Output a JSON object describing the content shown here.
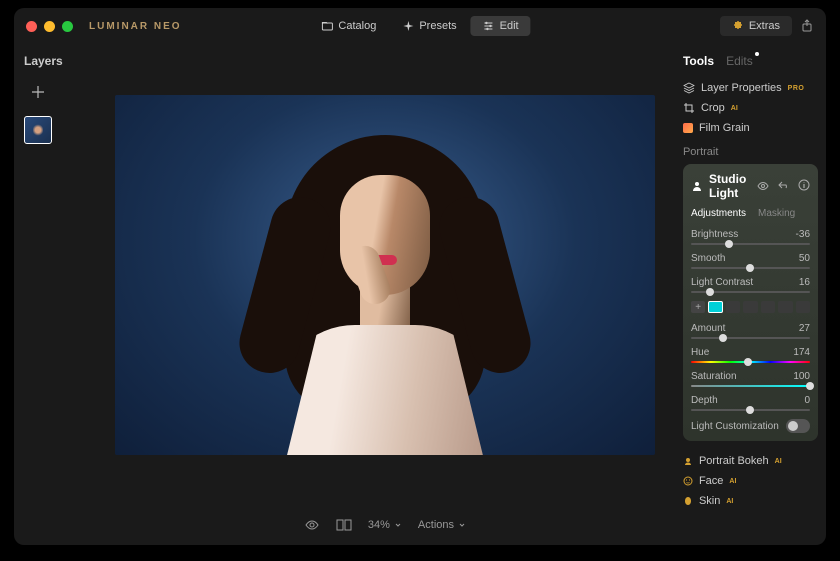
{
  "brand": "LUMINAR NEO",
  "nav": {
    "catalog": "Catalog",
    "presets": "Presets",
    "edit": "Edit",
    "extras": "Extras"
  },
  "left": {
    "title": "Layers"
  },
  "bottom": {
    "zoom": "34%",
    "actions": "Actions"
  },
  "tabs": {
    "tools": "Tools",
    "edits": "Edits"
  },
  "tools": {
    "layer_properties": "Layer Properties",
    "crop": "Crop",
    "film_grain": "Film Grain"
  },
  "portrait_section": "Portrait",
  "badges": {
    "pro": "PRO",
    "ai": "AI"
  },
  "studio": {
    "title": "Studio Light",
    "tab_adjustments": "Adjustments",
    "tab_masking": "Masking",
    "sliders": {
      "brightness": {
        "label": "Brightness",
        "value": "-36",
        "pos": 32
      },
      "smooth": {
        "label": "Smooth",
        "value": "50",
        "pos": 50
      },
      "light_contrast": {
        "label": "Light Contrast",
        "value": "16",
        "pos": 16
      },
      "amount": {
        "label": "Amount",
        "value": "27",
        "pos": 27
      },
      "hue": {
        "label": "Hue",
        "value": "174",
        "pos": 48
      },
      "saturation": {
        "label": "Saturation",
        "value": "100",
        "pos": 100
      },
      "depth": {
        "label": "Depth",
        "value": "0",
        "pos": 50
      }
    },
    "light_customization": "Light Customization"
  },
  "extra_tools": {
    "portrait_bokeh": "Portrait Bokeh",
    "face": "Face",
    "skin": "Skin"
  }
}
